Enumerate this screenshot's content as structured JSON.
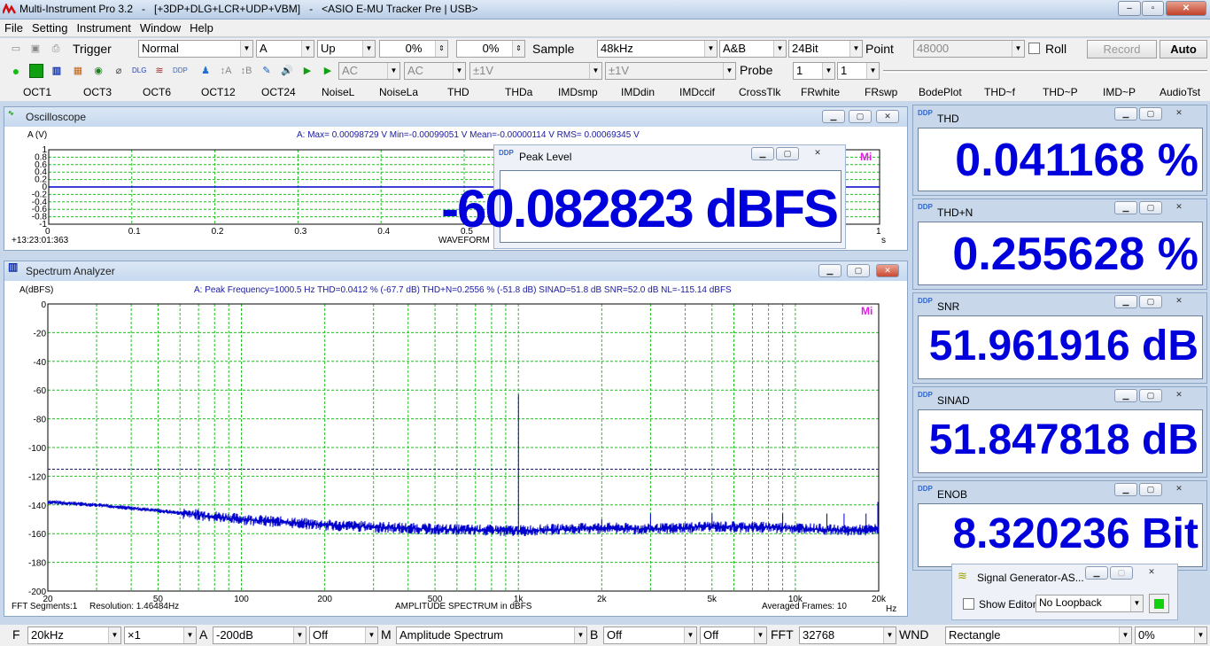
{
  "window": {
    "title": "Multi-Instrument Pro 3.2   -   [+3DP+DLG+LCR+UDP+VBM]   -   <ASIO E-MU Tracker Pre | USB>",
    "min": "0",
    "max": "1",
    "close": "X"
  },
  "menu": [
    "File",
    "Setting",
    "Instrument",
    "Window",
    "Help"
  ],
  "toolbar1": {
    "trigger_label": "Trigger",
    "trigger_mode": "Normal",
    "trigger_source": "A",
    "trigger_edge": "Up",
    "level1": "0%",
    "level2": "0%",
    "sample_label": "Sample",
    "sample_rate": "48kHz",
    "channels": "A&B",
    "bits": "24Bit",
    "point_label": "Point",
    "points": "48000",
    "roll_label": "Roll",
    "record_label": "Record",
    "auto_label": "Auto"
  },
  "toolbar2": {
    "coupling_a": "AC",
    "coupling_b": "AC",
    "range_a": "±1V",
    "range_b": "±1V",
    "probe_label": "Probe",
    "probe_a": "1",
    "probe_b": "1"
  },
  "quick_buttons": [
    "OCT1",
    "OCT3",
    "OCT6",
    "OCT12",
    "OCT24",
    "NoiseL",
    "NoiseLa",
    "THD",
    "THDa",
    "IMDsmp",
    "IMDdin",
    "IMDccif",
    "CrossTlk",
    "FRwhite",
    "FRswp",
    "BodePlot",
    "THD~f",
    "THD~P",
    "IMD~P",
    "AudioTst"
  ],
  "oscilloscope": {
    "title": "Oscilloscope",
    "ylabel": "A (V)",
    "info": "A: Max= 0.00098729 V  Min=-0.00099051 V  Mean=-0.00000114 V  RMS= 0.00069345 V",
    "yticks": [
      "1",
      "0.8",
      "0.6",
      "0.4",
      "0.2",
      "0",
      "-0.2",
      "-0.4",
      "-0.6",
      "-0.8",
      "-1"
    ],
    "xticks": [
      "0",
      "0.1",
      "0.2",
      "0.3",
      "0.4",
      "0.5",
      "0.6",
      "0.7",
      "0.8",
      "0.9",
      "1"
    ],
    "xlabel": "WAVEFORM",
    "xunit": "s",
    "timestamp": "+13:23:01:363",
    "logo": "Mi"
  },
  "peak_level": {
    "title": "Peak Level",
    "value": "-60.082823 dBFS"
  },
  "spectrum": {
    "title": "Spectrum Analyzer",
    "ylabel": "A(dBFS)",
    "info": "A: Peak Frequency=1000.5 Hz  THD=0.0412 % (-67.7 dB)  THD+N=0.2556 % (-51.8 dB)  SINAD=51.8 dB  SNR=52.0 dB  NL=-115.14 dBFS",
    "yticks": [
      "0",
      "-20",
      "-40",
      "-60",
      "-80",
      "-100",
      "-120",
      "-140",
      "-160",
      "-180",
      "-200"
    ],
    "xticks": [
      "20",
      "50",
      "100",
      "200",
      "500",
      "1k",
      "2k",
      "5k",
      "10k",
      "20k"
    ],
    "xunit": "Hz",
    "xlabel": "AMPLITUDE SPECTRUM in dBFS",
    "fft_segments": "FFT  Segments:1",
    "resolution": "Resolution: 1.46484Hz",
    "averaged": "Averaged Frames: 10",
    "logo": "Mi"
  },
  "chart_data": {
    "type": "line",
    "title": "AMPLITUDE SPECTRUM in dBFS",
    "xlabel": "Hz",
    "ylabel": "A(dBFS)",
    "x_scale": "log",
    "xlim": [
      20,
      20000
    ],
    "ylim": [
      -200,
      0
    ],
    "noise_level_line": -115.14,
    "series": [
      {
        "name": "A",
        "x": [
          20,
          30,
          50,
          100,
          200,
          500,
          1000,
          1000.5,
          1001,
          2000,
          3000,
          5000,
          10000,
          15000,
          20000
        ],
        "y": [
          -138,
          -140,
          -144,
          -150,
          -154,
          -157,
          -158,
          -63,
          -158,
          -156,
          -157,
          -155,
          -156,
          -158,
          -157
        ]
      }
    ]
  },
  "readouts": [
    {
      "title": "THD",
      "value": "0.041168 %"
    },
    {
      "title": "THD+N",
      "value": "0.255628 %"
    },
    {
      "title": "SNR",
      "value": "51.961916 dB"
    },
    {
      "title": "SINAD",
      "value": "51.847818 dB"
    },
    {
      "title": "ENOB",
      "value": "8.320236 Bit"
    }
  ],
  "signal_gen": {
    "title": "Signal Generator-AS...",
    "show_editor": "Show Editor",
    "loopback": "No Loopback"
  },
  "statusbar": {
    "f_label": "F",
    "f_value": "20kHz",
    "zoom": "×1",
    "a_label": "A",
    "a_value": "-200dB",
    "off1": "Off",
    "m_label": "M",
    "mode": "Amplitude Spectrum",
    "b_label": "B",
    "b_value": "Off",
    "off2": "Off",
    "fft_label": "FFT",
    "fft_size": "32768",
    "wnd_label": "WND",
    "window_fn": "Rectangle",
    "overlap": "0%"
  }
}
